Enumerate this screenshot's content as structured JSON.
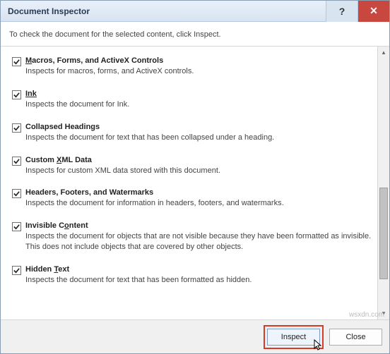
{
  "dialog": {
    "title": "Document Inspector",
    "instruction": "To check the document for the selected content, click Inspect."
  },
  "items": [
    {
      "title": "Macros, Forms, and ActiveX Controls",
      "desc": "Inspects for macros, forms, and ActiveX controls.",
      "checked": true
    },
    {
      "title": "Ink",
      "desc": "Inspects the document for Ink.",
      "checked": true
    },
    {
      "title": "Collapsed Headings",
      "desc": "Inspects the document for text that has been collapsed under a heading.",
      "checked": true
    },
    {
      "title": "Custom XML Data",
      "desc": "Inspects for custom XML data stored with this document.",
      "checked": true
    },
    {
      "title": "Headers, Footers, and Watermarks",
      "desc": "Inspects the document for information in headers, footers, and watermarks.",
      "checked": true
    },
    {
      "title": "Invisible Content",
      "desc": "Inspects the document for objects that are not visible because they have been formatted as invisible. This does not include objects that are covered by other objects.",
      "checked": true
    },
    {
      "title": "Hidden Text",
      "desc": "Inspects the document for text that has been formatted as hidden.",
      "checked": true
    }
  ],
  "buttons": {
    "inspect": "Inspect",
    "close": "Close"
  },
  "watermark": "wsxdn.com"
}
